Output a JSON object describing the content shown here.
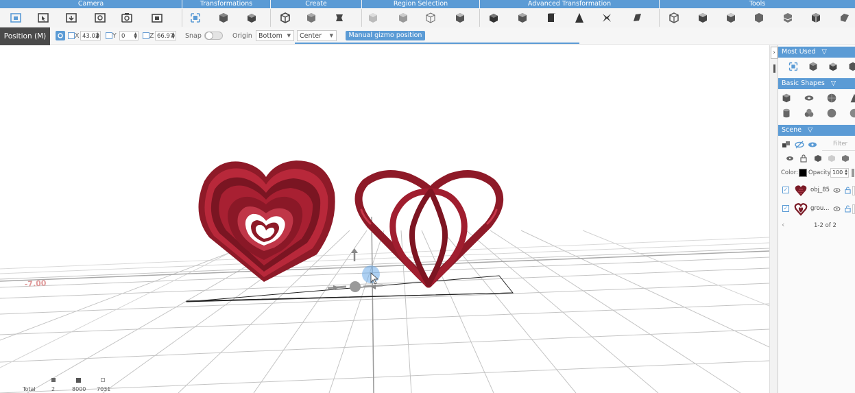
{
  "toolbar": {
    "sections": [
      {
        "key": "camera",
        "label": "Camera"
      },
      {
        "key": "transformations",
        "label": "Transformations"
      },
      {
        "key": "create",
        "label": "Create"
      },
      {
        "key": "region_selection",
        "label": "Region Selection"
      },
      {
        "key": "advanced_transformation",
        "label": "Advanced Transformation"
      },
      {
        "key": "tools",
        "label": "Tools"
      }
    ]
  },
  "position_bar": {
    "tab_label": "Position (M)",
    "x_label": "X",
    "x_value": "43.02",
    "y_label": "Y",
    "y_value": "0",
    "z_label": "Z",
    "z_value": "66.97",
    "snap_label": "Snap",
    "snap_on": false,
    "origin_label": "Origin",
    "origin_value": "Bottom",
    "center_value": "Center",
    "manual_gizmo_label": "Manual gizmo position"
  },
  "viewport": {
    "objects": [
      {
        "name": "spiral-heart",
        "color": "#9b1c2b"
      },
      {
        "name": "petal-heart",
        "color": "#9b1c2b"
      }
    ],
    "grid_label": "-7.00"
  },
  "stats": {
    "total_label": "Total",
    "objects": "2",
    "faces": "8000",
    "vertices": "7031"
  },
  "right_panel": {
    "most_used_title": "Most Used",
    "basic_shapes_title": "Basic Shapes",
    "scene_title": "Scene",
    "filter_placeholder": "Filter",
    "color_label": "Color:",
    "opacity_label": "Opacity:",
    "opacity_value": "100",
    "scene_items": [
      {
        "name": "obj_85"
      },
      {
        "name": "grou..."
      }
    ],
    "pagination": "1-2 of 2"
  },
  "colors": {
    "accent": "#5b9bd5",
    "object": "#9b1c2b",
    "dark_tab": "#4a4a4a"
  }
}
